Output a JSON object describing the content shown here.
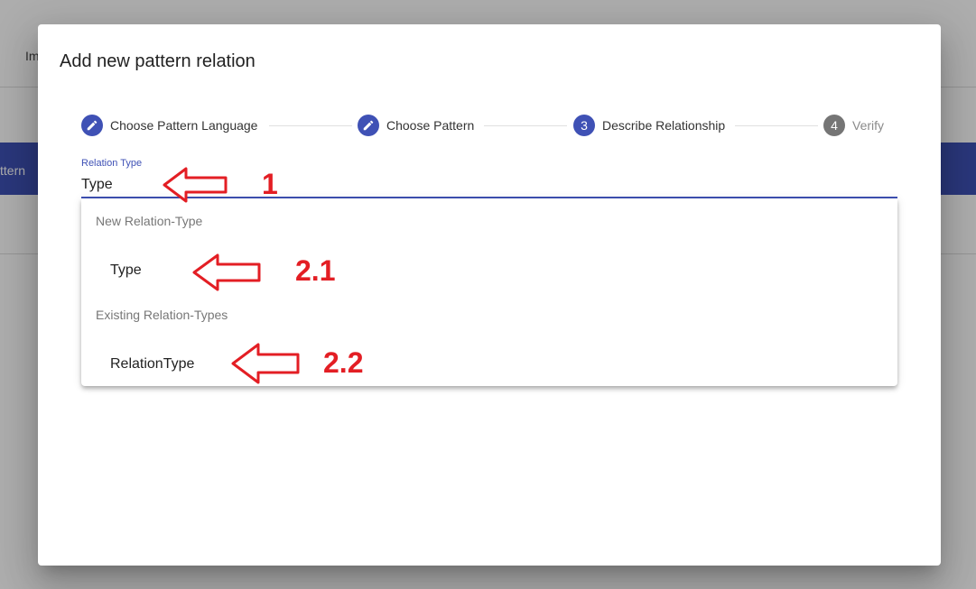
{
  "background": {
    "tab_fragment": "Im",
    "banner_fragment": "ttern"
  },
  "dialog": {
    "title": "Add new pattern relation"
  },
  "stepper": {
    "steps": [
      {
        "label": "Choose Pattern Language",
        "state": "done",
        "icon": "pencil-icon"
      },
      {
        "label": "Choose Pattern",
        "state": "done",
        "icon": "pencil-icon"
      },
      {
        "label": "Describe Relationship",
        "state": "active",
        "number": "3"
      },
      {
        "label": "Verify",
        "state": "pending",
        "number": "4"
      }
    ]
  },
  "field": {
    "label": "Relation Type",
    "value": "Type"
  },
  "autocomplete": {
    "groups": [
      {
        "label": "New Relation-Type",
        "options": [
          "Type"
        ]
      },
      {
        "label": "Existing Relation-Types",
        "options": [
          "RelationType"
        ]
      }
    ]
  },
  "annotations": {
    "a1": "1",
    "a21": "2.1",
    "a22": "2.2",
    "color": "#e31e24"
  },
  "colors": {
    "primary": "#3f51b5",
    "pending_step": "#757575"
  }
}
